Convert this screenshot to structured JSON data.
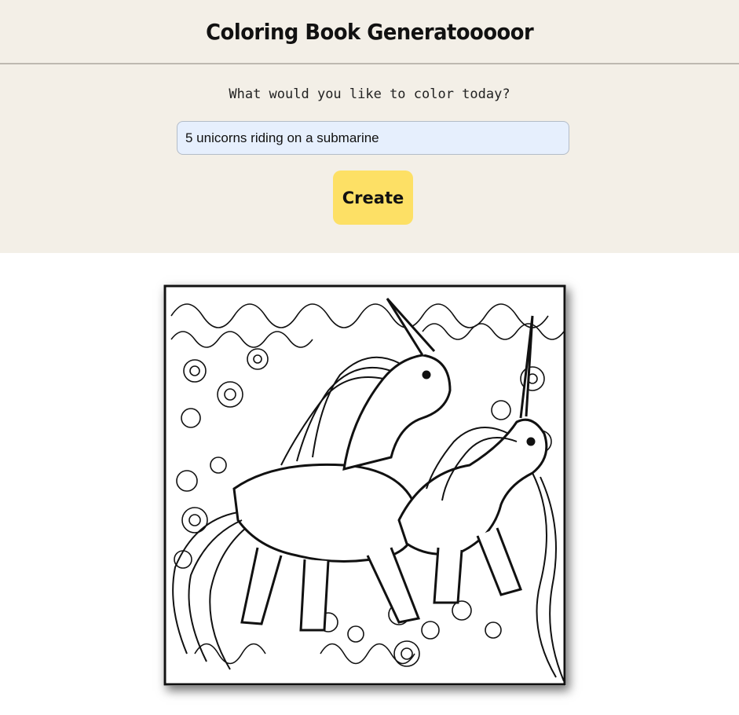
{
  "header": {
    "title": "Coloring Book Generatooooor"
  },
  "form": {
    "prompt_label": "What would you like to color today?",
    "input_value": "5 unicorns riding on a submarine",
    "create_label": "Create"
  },
  "result": {
    "subject": "unicorn-coloring-page-illustration"
  }
}
